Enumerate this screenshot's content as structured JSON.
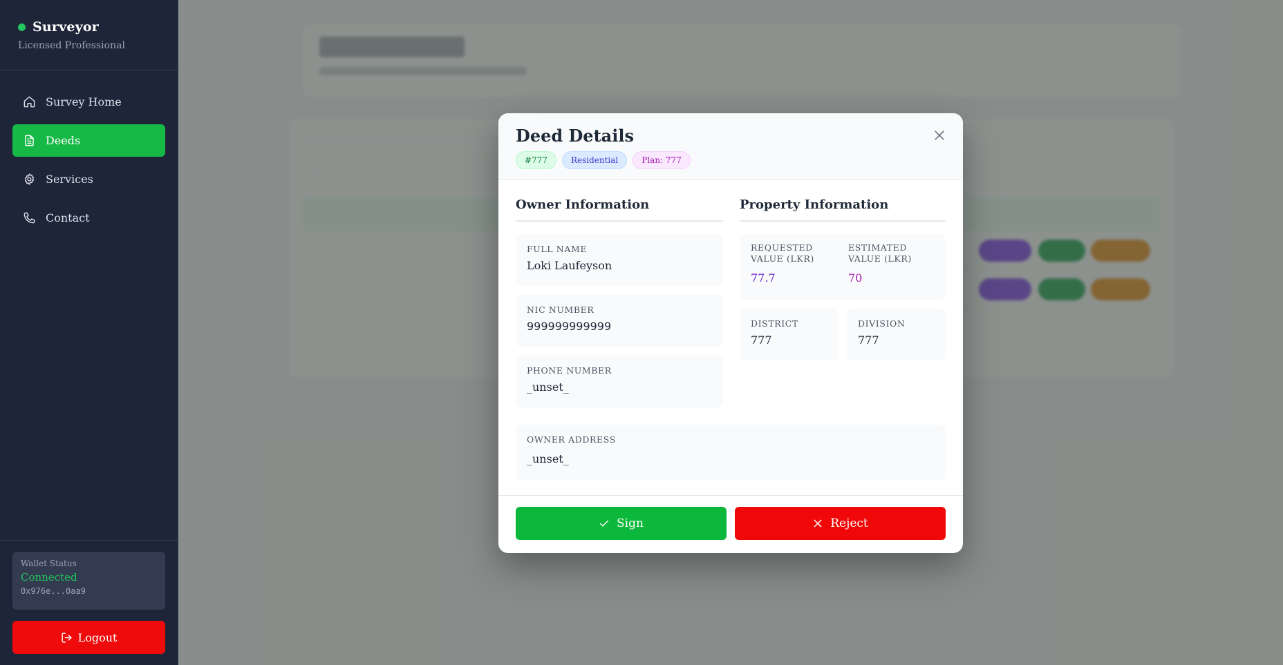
{
  "sidebar": {
    "brand": {
      "title": "Surveyor",
      "subtitle": "Licensed Professional"
    },
    "items": [
      {
        "label": "Survey Home",
        "icon": "home-icon"
      },
      {
        "label": "Deeds",
        "icon": "document-icon",
        "active": true
      },
      {
        "label": "Services",
        "icon": "gear-icon"
      },
      {
        "label": "Contact",
        "icon": "phone-icon"
      }
    ],
    "wallet": {
      "label": "Wallet Status",
      "status": "Connected",
      "address": "0x976e...0aa9"
    },
    "logout_label": "Logout"
  },
  "colors": {
    "sidebar_bg": "#1e2538",
    "accent_green": "#16b846",
    "danger_red": "#f00808",
    "requested_value": "#6d28d9",
    "estimated_value": "#a21caf"
  },
  "modal": {
    "title": "Deed Details",
    "badges": {
      "id": "#777",
      "type": "Residential",
      "plan": "Plan: 777"
    },
    "owner": {
      "section_title": "Owner Information",
      "full_name_label": "FULL NAME",
      "full_name": "Loki Laufeyson",
      "nic_label": "NIC NUMBER",
      "nic": "999999999999",
      "phone_label": "PHONE NUMBER",
      "phone": "_unset_",
      "address_label": "OWNER ADDRESS",
      "address": "_unset_"
    },
    "property": {
      "section_title": "Property Information",
      "requested_label": "REQUESTED VALUE (LKR)",
      "requested": "77.7",
      "estimated_label": "ESTIMATED VALUE (LKR)",
      "estimated": "70",
      "district_label": "DISTRICT",
      "district": "777",
      "division_label": "DIVISION",
      "division": "777"
    },
    "sign_label": "Sign",
    "reject_label": "Reject"
  }
}
